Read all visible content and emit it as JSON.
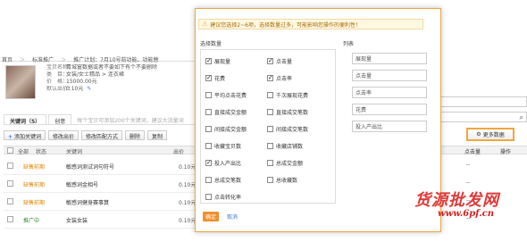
{
  "breadcrumb": {
    "items": [
      "首页",
      "标准推广",
      "推广计划：7月10号前功能、功能替",
      "宝贝推广"
    ],
    "sep": "＞"
  },
  "product": {
    "title_label": "宝贝名称：",
    "title": "青城窗数据或者不要如下有个不要删除",
    "category_label": "类　目：",
    "category": "女装/女士精品 > 连衣裙",
    "price_label": "价　格：",
    "price": "15000.00元",
    "bid_label": "默认出价：",
    "bid": "0.10元"
  },
  "keyword_tabs": {
    "keywords_tab": "关键词（5）",
    "second_tab": "创意",
    "hint": "每个宝贝可添加200个关键词，建议大流量词和精准词"
  },
  "toolbar": {
    "add_label": "添加关键词",
    "edit_bid_label": "修改出价",
    "edit_match_label": "修改匹配方式",
    "delete_label": "删除",
    "copy_label": "复制"
  },
  "table": {
    "headers": [
      "全部",
      "状态",
      "关键词",
      "出价"
    ],
    "rows": [
      {
        "status": "缺售前期",
        "status_color": "orange",
        "keyword": "敏感词测试词句符号",
        "price": "0.10元"
      },
      {
        "status": "缺售前期",
        "status_color": "orange",
        "keyword": "敏感词金相号",
        "price": "0.10元"
      },
      {
        "status": "缺售前期",
        "status_color": "orange",
        "keyword": "敏感词健身赛事算",
        "price": "0.10元"
      },
      {
        "status": "推广中",
        "status_color": "green",
        "keyword": "女装女装",
        "price": "0.10元"
      }
    ]
  },
  "right_panel": {
    "input_value": "8天",
    "more_data_label": "更多数据",
    "headers": [
      "点击量",
      "操作"
    ],
    "cells": [
      "--",
      "--",
      "--",
      "--"
    ]
  },
  "dialog": {
    "warning": "建议您选择2~6项，选择数量过多，可能影响您操作的便利性！",
    "warning_link": "",
    "choose_title": "选择数量",
    "list_title": "列表",
    "options": [
      {
        "label": "展现量",
        "checked": true
      },
      {
        "label": "点击量",
        "checked": true
      },
      {
        "label": "花费",
        "checked": true
      },
      {
        "label": "点击率",
        "checked": true
      },
      {
        "label": "平均点击花费",
        "checked": false
      },
      {
        "label": "千次展现花费",
        "checked": false
      },
      {
        "label": "直接成交金额",
        "checked": false
      },
      {
        "label": "直接成交笔数",
        "checked": false
      },
      {
        "label": "间接成交金额",
        "checked": false
      },
      {
        "label": "间接成交笔数",
        "checked": false
      },
      {
        "label": "收藏宝贝数",
        "checked": false
      },
      {
        "label": "收藏店铺数",
        "checked": false
      },
      {
        "label": "投入产出比",
        "checked": true
      },
      {
        "label": "总成交金额",
        "checked": false
      },
      {
        "label": "总成交笔数",
        "checked": false
      },
      {
        "label": "总收藏数",
        "checked": false
      },
      {
        "label": "点击转化率",
        "checked": false
      }
    ],
    "list": [
      "展现量",
      "点击量",
      "点击率",
      "花费",
      "投入产出比"
    ],
    "ok_label": "确定",
    "cancel_label": "取消"
  },
  "watermark": {
    "text": "货源批发网",
    "url": "www.6pf.cn"
  }
}
